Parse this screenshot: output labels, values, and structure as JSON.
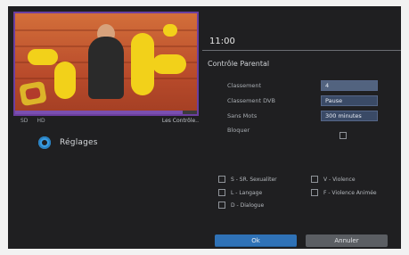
{
  "time": "11:00",
  "panel_title": "Contrôle Parental",
  "left": {
    "info_left_1": "SD",
    "info_left_2": "HD",
    "channel_title": "Les Contrôle..",
    "settings_label": "Réglages",
    "progress": 0.92
  },
  "form": {
    "rows": [
      {
        "label": "Classement",
        "value": "4"
      },
      {
        "label": "Classement DVB",
        "value": "Pause"
      },
      {
        "label": "Sans Mots",
        "value": "300 minutes"
      },
      {
        "label": "Bloquer",
        "value": ""
      }
    ]
  },
  "categories": {
    "left": [
      "S - SR. Sexualiter",
      "L - Langage",
      "D - Dialogue"
    ],
    "right": [
      "V - Violence",
      "F - Violence Animée"
    ]
  },
  "buttons": {
    "ok": "Ok",
    "cancel": "Annuler"
  },
  "colors": {
    "accent_blue": "#2f72b7",
    "field_bg": "#3a4a66",
    "panel_bg": "#1f1f21",
    "video_border": "#6b3fa0"
  }
}
